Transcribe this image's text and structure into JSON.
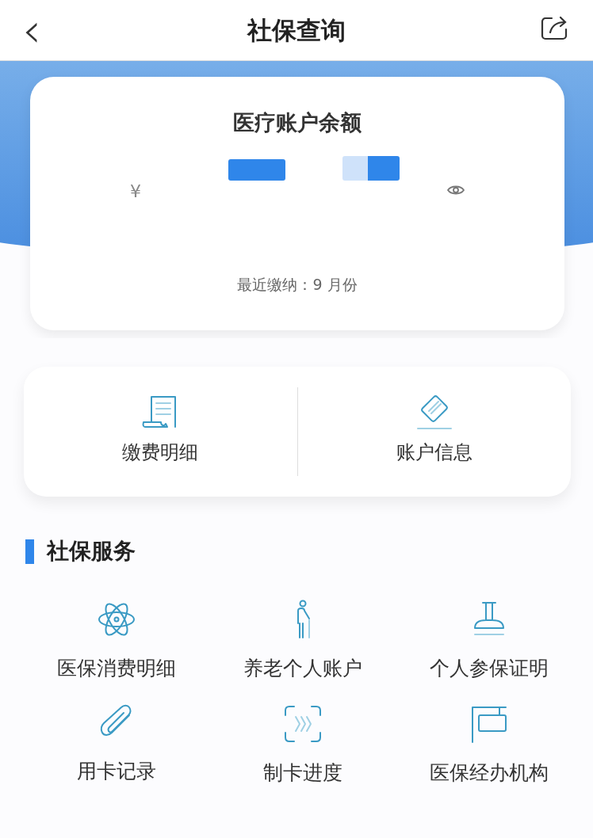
{
  "header": {
    "back_icon": "‹",
    "title": "社保查询"
  },
  "balance_card": {
    "title": "医疗账户余额",
    "currency": "¥",
    "last_payment_label": "最近缴纳：",
    "last_payment_month": "9 月份"
  },
  "quick_actions": [
    {
      "label": "缴费明细"
    },
    {
      "label": "账户信息"
    }
  ],
  "section": {
    "title": "社保服务"
  },
  "services": [
    {
      "label": "医保消费明细"
    },
    {
      "label": "养老个人账户"
    },
    {
      "label": "个人参保证明"
    },
    {
      "label": "用卡记录"
    },
    {
      "label": "制卡进度"
    },
    {
      "label": "医保经办机构"
    }
  ]
}
